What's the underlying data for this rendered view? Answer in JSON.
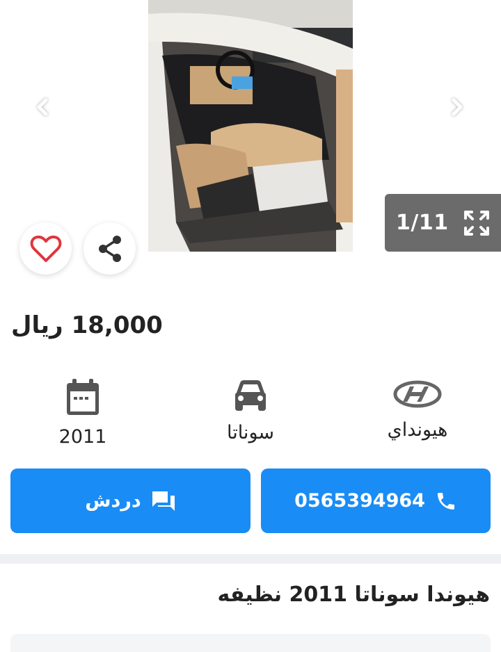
{
  "gallery": {
    "counter": "1/11",
    "prev_icon": "chevron-left-icon",
    "next_icon": "chevron-right-icon",
    "fullscreen_icon": "expand-icon",
    "favorite_icon": "heart-outline-icon",
    "share_icon": "share-icon",
    "colors": {
      "heart": "#e0353d",
      "counter_bg": "#6b6b6b"
    }
  },
  "listing": {
    "price_value": "18,000",
    "price_currency": "ريال",
    "title": "هيوندا سوناتا 2011 نظيفه"
  },
  "specs": {
    "year": {
      "icon": "calendar-icon",
      "label": "2011"
    },
    "model": {
      "icon": "car-icon",
      "label": "سوناتا"
    },
    "make": {
      "icon": "hyundai-logo-icon",
      "label": "هيونداي"
    }
  },
  "actions": {
    "chat": {
      "label": "دردش",
      "icon": "chat-icon"
    },
    "call": {
      "label": "0565394964",
      "icon": "phone-icon"
    },
    "accent": "#1a8cf5"
  }
}
